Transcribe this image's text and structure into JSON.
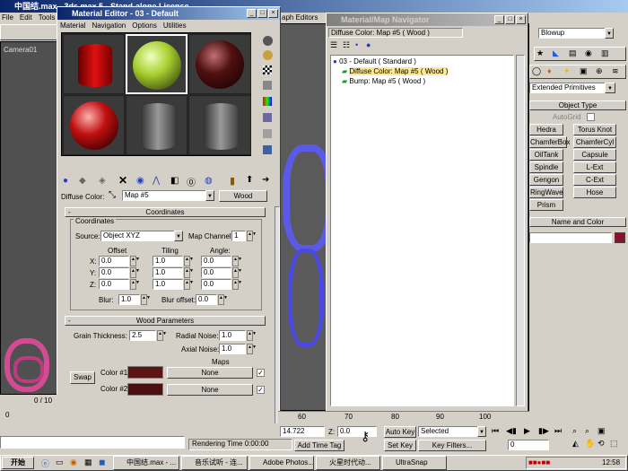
{
  "app": {
    "title": "中国结.max - 3ds max 5 - Stand-alone License",
    "menu": [
      "File",
      "Edit",
      "Tools"
    ],
    "menu_tail": "aph Editors"
  },
  "viewport": {
    "label": "Camera01"
  },
  "material_editor": {
    "title": "Material Editor - 03 - Default",
    "menu": [
      "Material",
      "Navigation",
      "Options",
      "Utilities"
    ],
    "diffuse_label": "Diffuse Color:",
    "map_name": "Map #5",
    "map_type": "Wood",
    "coordinates": {
      "header": "Coordinates",
      "group_label": "Coordinates",
      "source_label": "Source:",
      "source_value": "Object XYZ",
      "map_channel_label": "Map Channel:",
      "map_channel_value": "1",
      "col_offset": "Offset",
      "col_tiling": "Tiling",
      "col_angle": "Angle:",
      "rows": [
        {
          "axis": "X:",
          "offset": "0.0",
          "tiling": "1.0",
          "angle": "0.0"
        },
        {
          "axis": "Y:",
          "offset": "0.0",
          "tiling": "1.0",
          "angle": "0.0"
        },
        {
          "axis": "Z:",
          "offset": "0.0",
          "tiling": "1.0",
          "angle": "0.0"
        }
      ],
      "blur_label": "Blur:",
      "blur_value": "1.0",
      "blur_offset_label": "Blur offset:",
      "blur_offset_value": "0.0"
    },
    "wood": {
      "header": "Wood Parameters",
      "grain_label": "Grain Thickness:",
      "grain_value": "2.5",
      "radial_label": "Radial Noise:",
      "radial_value": "1.0",
      "axial_label": "Axial Noise:",
      "axial_value": "1.0",
      "maps_label": "Maps",
      "swap_label": "Swap",
      "color1_label": "Color #1",
      "color2_label": "Color #2",
      "map1": "None",
      "map2": "None",
      "color1": "#5a1414",
      "color2": "#4a1010"
    }
  },
  "navigator": {
    "title": "Material/Map Navigator",
    "path": "Diffuse Color: Map #5 ( Wood )",
    "tree": [
      {
        "label": "03 - Default  ( Standard )"
      },
      {
        "label": "Diffuse Color: Map #5  ( Wood )",
        "selected": true
      },
      {
        "label": "Bump: Map #5  ( Wood )"
      }
    ]
  },
  "command_panel": {
    "dropdown_top": "Blowup",
    "category": "Extended Primitives",
    "object_type_header": "Object Type",
    "autogrid": "AutoGrid",
    "buttons": [
      "Hedra",
      "Torus Knot",
      "ChamferBox",
      "ChamferCyl",
      "OilTank",
      "Capsule",
      "Spindle",
      "L-Ext",
      "Gengon",
      "C-Ext",
      "RingWave",
      "Hose",
      "Prism"
    ],
    "name_color_header": "Name and Color",
    "object_color": "#8a1030"
  },
  "timeline": {
    "ticks": [
      "60",
      "70",
      "80",
      "90",
      "100"
    ],
    "frame_readout": "0 / 10"
  },
  "status": {
    "coord_y": "14.722",
    "coord_z": "0.0",
    "rendering_time": "Rendering Time  0:00:00",
    "add_time_tag": "Add Time Tag",
    "auto_key": "Auto Key",
    "selected": "Selected",
    "set_key": "Set Key",
    "key_filters": "Key Filters...",
    "frame": "0"
  },
  "taskbar": {
    "start": "开始",
    "tasks": [
      "中国结.max - ...",
      "音乐试听 - 连...",
      "Adobe Photos...",
      "火星时代动...",
      "UltraSnap"
    ],
    "clock": "12:58"
  }
}
